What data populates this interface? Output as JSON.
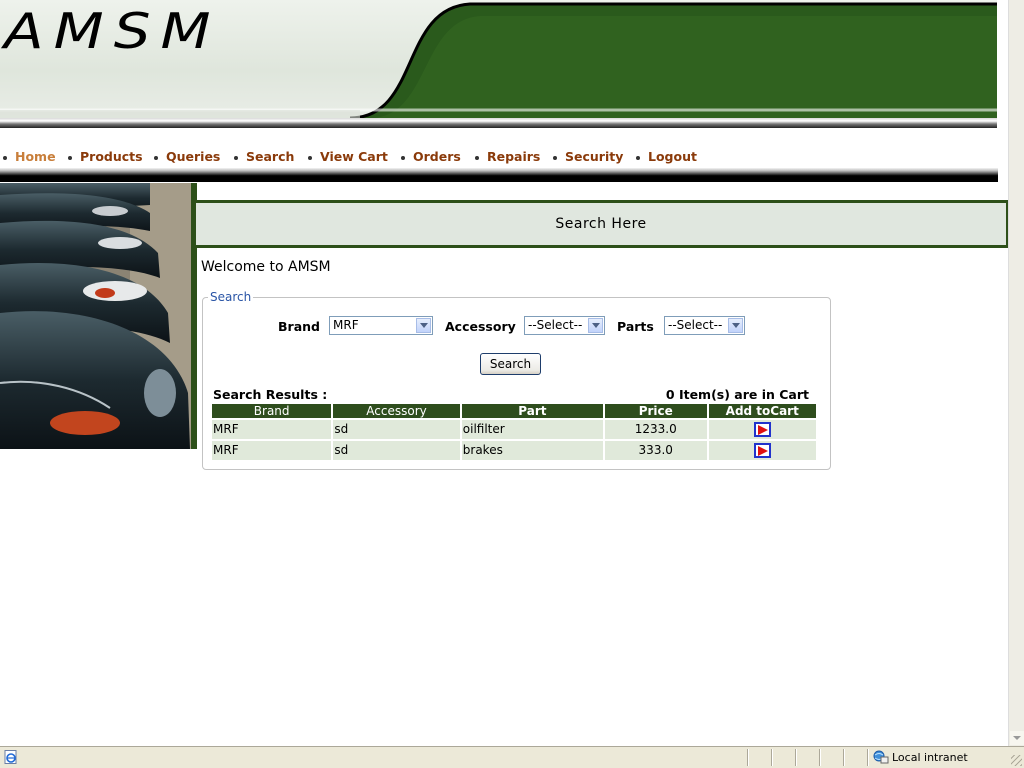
{
  "banner": {
    "logo_text": "AMSM"
  },
  "nav": {
    "items": [
      {
        "label": "Home",
        "active": true
      },
      {
        "label": "Products"
      },
      {
        "label": "Queries"
      },
      {
        "label": "Search"
      },
      {
        "label": "View Cart"
      },
      {
        "label": "Orders"
      },
      {
        "label": "Repairs"
      },
      {
        "label": "Security"
      },
      {
        "label": "Logout"
      }
    ]
  },
  "main": {
    "section_title": "Search Here",
    "welcome": "Welcome to AMSM"
  },
  "search_form": {
    "legend": "Search",
    "brand_label": "Brand",
    "brand_value": "MRF",
    "accessory_label": "Accessory",
    "accessory_value": "--Select--",
    "parts_label": "Parts",
    "parts_value": "--Select--",
    "search_button": "Search"
  },
  "results": {
    "label": "Search Results :",
    "cart_count": "0 Item(s) are in Cart",
    "columns": [
      "Brand",
      "Accessory",
      "Part",
      "Price",
      "Add toCart"
    ],
    "rows": [
      {
        "brand": "MRF",
        "accessory": "sd",
        "part": "oilfilter",
        "price": "1233.0"
      },
      {
        "brand": "MRF",
        "accessory": "sd",
        "part": "brakes",
        "price": "333.0"
      }
    ]
  },
  "statusbar": {
    "zone": "Local intranet"
  },
  "colors": {
    "dark_green": "#2e4d1d",
    "nav_link": "#8a3a0a",
    "nav_active": "#c87e3a",
    "row_bg": "#e0e9da",
    "legend": "#2a55a6"
  },
  "icons": [
    "ie-page-icon",
    "local-intranet-icon",
    "add-to-cart-icon",
    "dropdown-arrow-icon"
  ]
}
